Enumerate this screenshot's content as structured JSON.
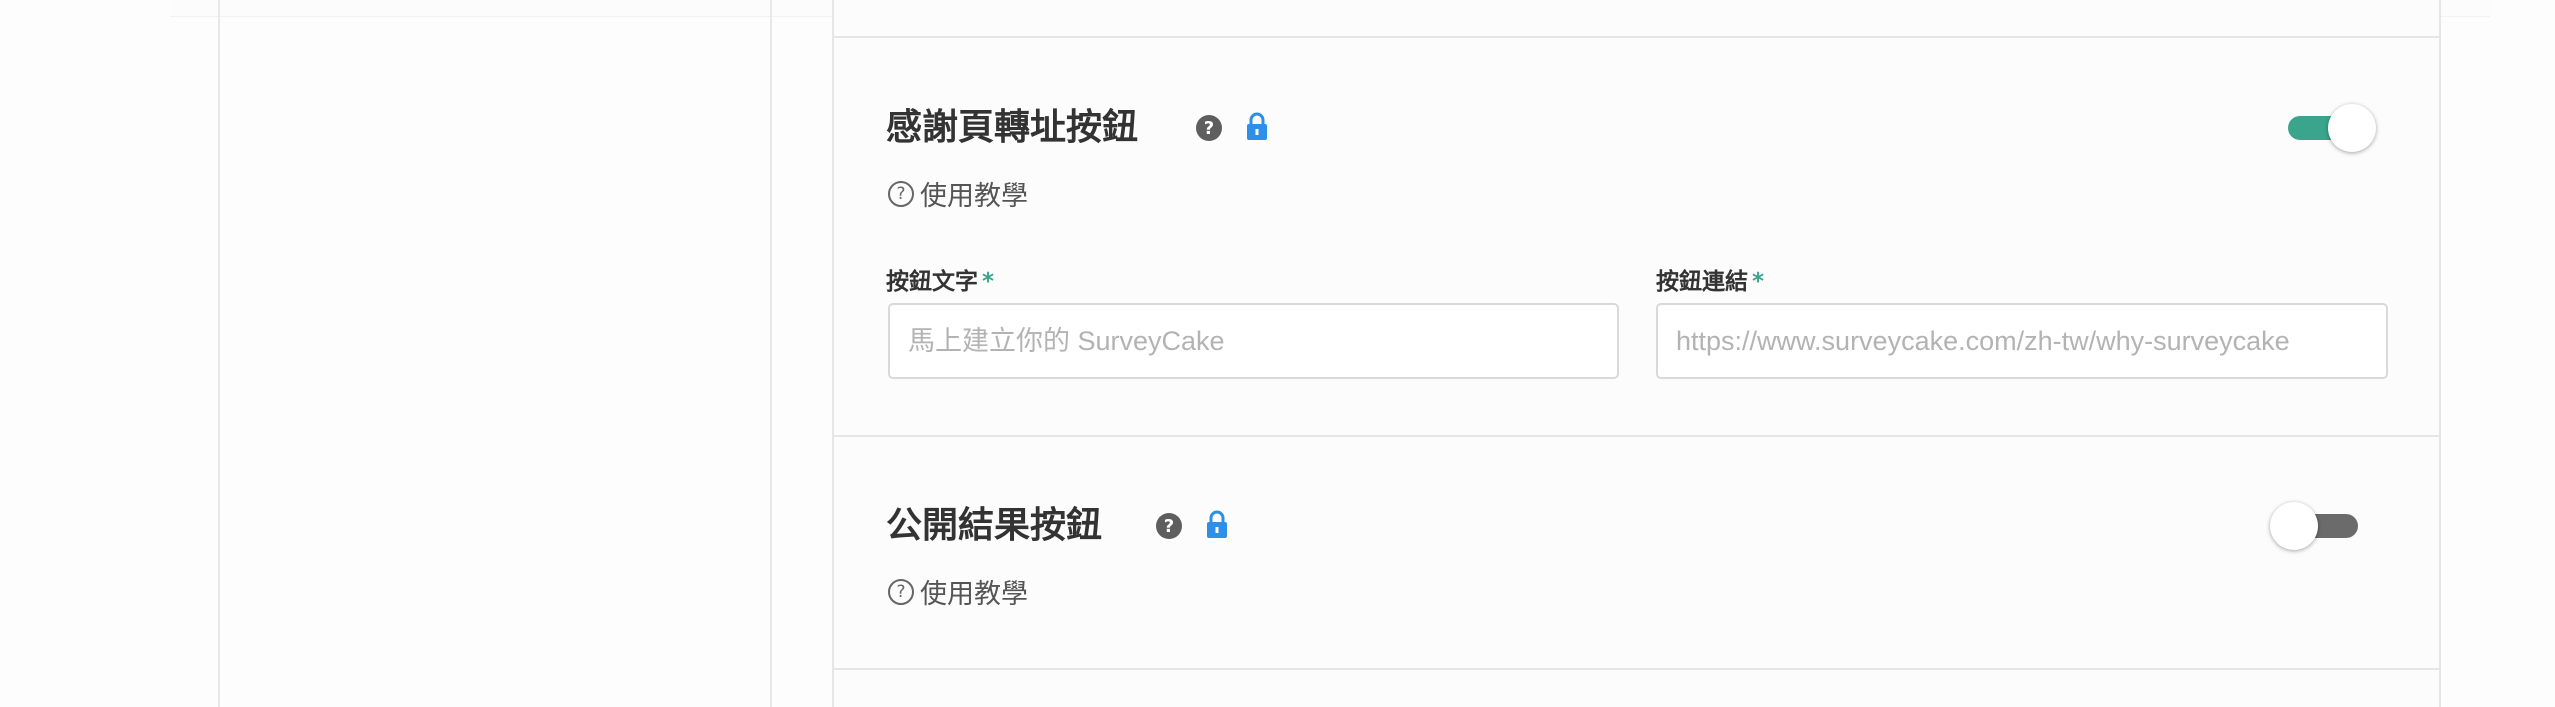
{
  "settings": [
    {
      "title": "感謝頁轉址按鈕",
      "help_glyph": "?",
      "tutorial_label": "使用教學",
      "enabled": true,
      "fields": [
        {
          "label": "按鈕文字",
          "required_mark": "*",
          "placeholder": "馬上建立你的 SurveyCake"
        },
        {
          "label": "按鈕連結",
          "required_mark": "*",
          "placeholder": "https://www.surveycake.com/zh-tw/why-surveycake"
        }
      ]
    },
    {
      "title": "公開結果按鈕",
      "help_glyph": "?",
      "tutorial_label": "使用教學",
      "enabled": false
    }
  ],
  "icons": {
    "help": "question-circle-icon",
    "lock": "lock-icon",
    "tutorial": "question-outline-icon"
  },
  "colors": {
    "accent": "#3aa58c",
    "lock": "#2e8fe8",
    "toggle_off": "#6b6b6b",
    "required": "#3aa58c"
  }
}
